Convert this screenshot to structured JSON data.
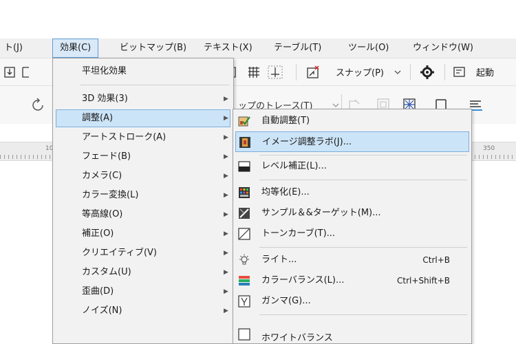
{
  "menubar": {
    "items": [
      {
        "label": "ト(J)"
      },
      {
        "label": "効果(C)"
      },
      {
        "label": "ビットマップ(B)"
      },
      {
        "label": "テキスト(X)"
      },
      {
        "label": "テーブル(T)"
      },
      {
        "label": "ツール(O)"
      },
      {
        "label": "ウィンドウ(W)"
      }
    ]
  },
  "toolbar1": {
    "snap_label": "スナップ(P)",
    "launch_label": "起動"
  },
  "toolbar2": {
    "trace_label": "ップのトレース(T)"
  },
  "ruler": {
    "label_left": "10",
    "label_right": "350"
  },
  "effects_menu": {
    "items": [
      {
        "label": "平坦化効果",
        "has_submenu": false
      },
      {
        "label": "3D 効果(3)",
        "has_submenu": true
      },
      {
        "label": "調整(A)",
        "has_submenu": true,
        "highlighted": true
      },
      {
        "label": "アートストローク(A)",
        "has_submenu": true
      },
      {
        "label": "フェード(B)",
        "has_submenu": true
      },
      {
        "label": "カメラ(C)",
        "has_submenu": true
      },
      {
        "label": "カラー変換(L)",
        "has_submenu": true
      },
      {
        "label": "等高線(O)",
        "has_submenu": true
      },
      {
        "label": "補正(O)",
        "has_submenu": true
      },
      {
        "label": "クリエイティブ(V)",
        "has_submenu": true
      },
      {
        "label": "カスタム(U)",
        "has_submenu": true
      },
      {
        "label": "歪曲(D)",
        "has_submenu": true
      },
      {
        "label": "ノイズ(N)",
        "has_submenu": true
      }
    ]
  },
  "adjust_submenu": {
    "items": [
      {
        "label": "自動調整(T)",
        "icon": "auto-adjust-icon",
        "shortcut": ""
      },
      {
        "label": "イメージ調整ラボ(J)...",
        "icon": "image-adjust-lab-icon",
        "shortcut": "",
        "highlighted": true
      },
      {
        "label": "レベル補正(L)...",
        "icon": "level-correction-icon",
        "shortcut": ""
      },
      {
        "label": "均等化(E)...",
        "icon": "equalize-icon",
        "shortcut": ""
      },
      {
        "label": "サンプル＆&ターゲット(M)...",
        "icon": "sample-target-icon",
        "shortcut": ""
      },
      {
        "label": "トーンカーブ(T)...",
        "icon": "tone-curve-icon",
        "shortcut": ""
      },
      {
        "label": "ライト...",
        "icon": "light-icon",
        "shortcut": "Ctrl+B"
      },
      {
        "label": "カラーバランス(L)...",
        "icon": "color-balance-icon",
        "shortcut": "Ctrl+Shift+B"
      },
      {
        "label": "ガンマ(G)...",
        "icon": "gamma-icon",
        "shortcut": ""
      },
      {
        "label": "ホワイトバランス",
        "icon": "white-balance-icon",
        "shortcut": ""
      }
    ]
  },
  "colors": {
    "highlight_bg": "#cce4f7",
    "highlight_border": "#7aaede",
    "menu_bg": "#f2f2f2",
    "menubar_active": "#d9e9f8"
  }
}
